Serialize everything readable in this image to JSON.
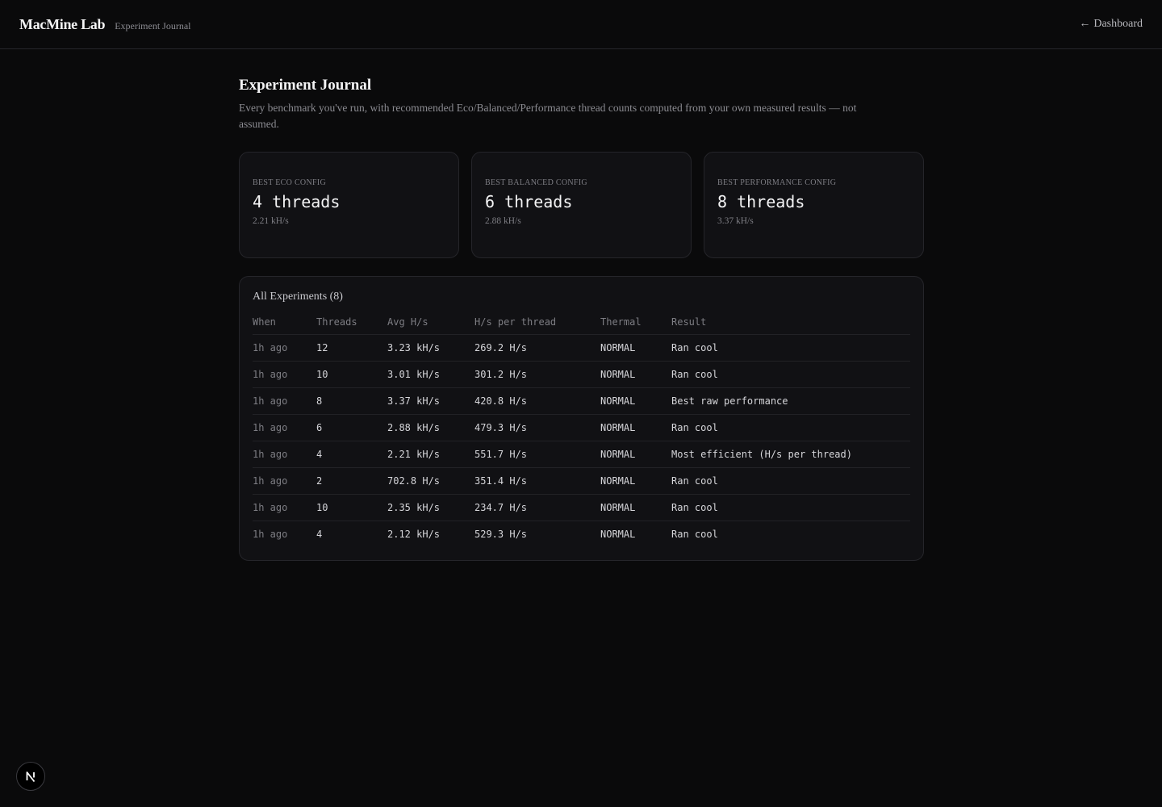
{
  "header": {
    "brand": "MacMine Lab",
    "subtitle": "Experiment Journal",
    "back_arrow": "←",
    "back_label": "Dashboard"
  },
  "page": {
    "title": "Experiment Journal",
    "description": "Every benchmark you've run, with recommended Eco/Balanced/Performance thread counts computed from your own measured results — not assumed."
  },
  "cards": [
    {
      "label": "BEST ECO CONFIG",
      "value": "4 threads",
      "sub": "2.21 kH/s"
    },
    {
      "label": "BEST BALANCED CONFIG",
      "value": "6 threads",
      "sub": "2.88 kH/s"
    },
    {
      "label": "BEST PERFORMANCE CONFIG",
      "value": "8 threads",
      "sub": "3.37 kH/s"
    }
  ],
  "table": {
    "title": "All Experiments (8)",
    "columns": [
      "When",
      "Threads",
      "Avg H/s",
      "H/s per thread",
      "Thermal",
      "Result"
    ],
    "rows": [
      [
        "1h ago",
        "12",
        "3.23 kH/s",
        "269.2 H/s",
        "NORMAL",
        "Ran cool"
      ],
      [
        "1h ago",
        "10",
        "3.01 kH/s",
        "301.2 H/s",
        "NORMAL",
        "Ran cool"
      ],
      [
        "1h ago",
        "8",
        "3.37 kH/s",
        "420.8 H/s",
        "NORMAL",
        "Best raw performance"
      ],
      [
        "1h ago",
        "6",
        "2.88 kH/s",
        "479.3 H/s",
        "NORMAL",
        "Ran cool"
      ],
      [
        "1h ago",
        "4",
        "2.21 kH/s",
        "551.7 H/s",
        "NORMAL",
        "Most efficient (H/s per thread)"
      ],
      [
        "1h ago",
        "2",
        "702.8 H/s",
        "351.4 H/s",
        "NORMAL",
        "Ran cool"
      ],
      [
        "1h ago",
        "10",
        "2.35 kH/s",
        "234.7 H/s",
        "NORMAL",
        "Ran cool"
      ],
      [
        "1h ago",
        "4",
        "2.12 kH/s",
        "529.3 H/s",
        "NORMAL",
        "Ran cool"
      ]
    ]
  },
  "fab": {
    "icon": "nextjs-logo-icon"
  }
}
